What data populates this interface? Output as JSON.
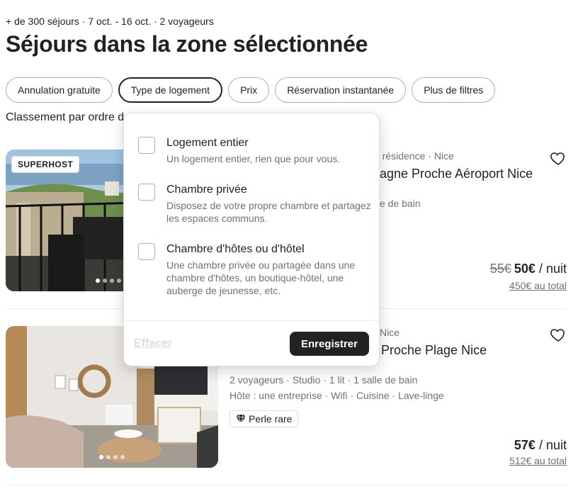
{
  "header": {
    "subtitle": "+ de 300 séjours · 7 oct. - 16 oct. · 2 voyageurs",
    "title": "Séjours dans la zone sélectionnée"
  },
  "filters": [
    {
      "label": "Annulation gratuite"
    },
    {
      "label": "Type de logement",
      "active": true
    },
    {
      "label": "Prix"
    },
    {
      "label": "Réservation instantanée"
    },
    {
      "label": "Plus de filtres"
    }
  ],
  "sort": {
    "text": "Classement par ordre d"
  },
  "listings": [
    {
      "badge": "SUPERHOST",
      "type_line": "n résidence · Nice",
      "name": "agne Proche Aéroport Nice",
      "details": "e de bain",
      "old_price": "55€",
      "price": "50€",
      "per": "/ nuit",
      "total": "450€ au total"
    },
    {
      "type_line": "Nice",
      "name": "Proche Plage Nice",
      "details": "2 voyageurs · Studio · 1 lit · 1 salle de bain",
      "amenities": "Hôte : une entreprise · Wifi · Cuisine · Lave-linge",
      "rare_badge": "Perle rare",
      "price": "57€",
      "per": "/ nuit",
      "total": "512€ au total"
    }
  ],
  "dropdown": {
    "options": [
      {
        "label": "Logement entier",
        "description": "Un logement entier, rien que pour vous."
      },
      {
        "label": "Chambre privée",
        "description": "Disposez de votre propre chambre et partagez les espaces communs."
      },
      {
        "label": "Chambre d'hôtes ou d'hôtel",
        "description": "Une chambre privée ou partagée dans une chambre d'hôtes, un boutique-hôtel, une auberge de jeunesse, etc."
      }
    ],
    "clear_label": "Effacer",
    "save_label": "Enregistrer"
  },
  "icons": {
    "favorite": "heart-icon",
    "rare": "diamond-icon"
  }
}
